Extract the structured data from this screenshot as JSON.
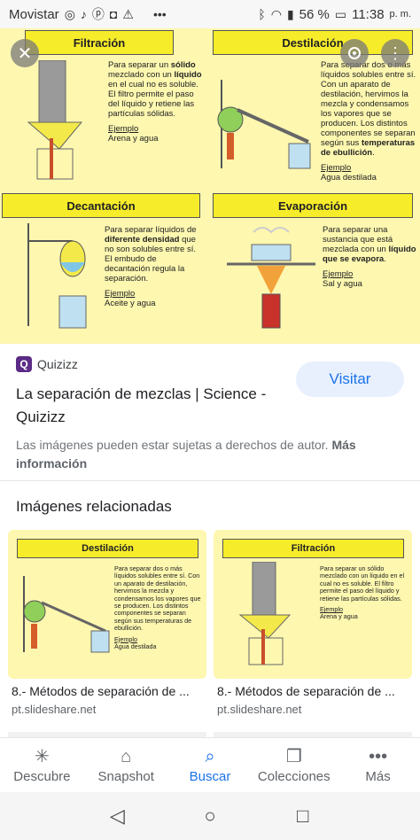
{
  "status_bar": {
    "carrier": "Movistar",
    "battery": "56 %",
    "time": "11:38",
    "ampm": "p. m."
  },
  "image": {
    "panels": [
      {
        "title": "Filtración",
        "text_parts": [
          "Para separar un ",
          "sólido",
          " mezclado con un ",
          "líquido",
          " en el cual no es soluble. El filtro permite el paso del líquido y retiene las partículas sólidas."
        ],
        "ejemplo_label": "Ejemplo",
        "ejemplo_value": "Arena y agua"
      },
      {
        "title": "Destilación",
        "text_parts": [
          "Para separar dos o más líquidos solubles entre sí. Con un aparato de destilación, hervimos la mezcla y condensamos los vapores que se producen. Los distintos componentes se separan según sus ",
          "temperaturas de ebullición",
          "."
        ],
        "ejemplo_label": "Ejemplo",
        "ejemplo_value": "Agua destilada"
      },
      {
        "title": "Decantación",
        "text_parts": [
          "Para separar líquidos de ",
          "diferente densidad",
          " que no son solubles entre sí. El embudo de decantación regula la separación."
        ],
        "ejemplo_label": "Ejemplo",
        "ejemplo_value": "Aceite y agua"
      },
      {
        "title": "Evaporación",
        "text_parts": [
          "Para separar una sustancia que está mezclada con un ",
          "líquido que se evapora",
          "."
        ],
        "ejemplo_label": "Ejemplo",
        "ejemplo_value": "Sal y agua"
      }
    ]
  },
  "source": {
    "name": "Quizizz",
    "favicon_letter": "Q",
    "visit_label": "Visitar",
    "title": "La separación de mezclas | Science - Quizizz",
    "copyright": "Las imágenes pueden estar sujetas a derechos de autor.",
    "more_info": "Más información"
  },
  "related": {
    "heading": "Imágenes relacionadas",
    "items": [
      {
        "thumb_title": "Destilación",
        "thumb_text": "Para separar dos o más líquidos solubles entre sí. Con un aparato de destilación, hervimos la mezcla y condensamos los vapores que se producen. Los distintos componentes se separan según sus temperaturas de ebullición.",
        "thumb_ejemplo": "Ejemplo",
        "thumb_value": "Agua destilada",
        "caption": "8.- Métodos de separación de ...",
        "source": "pt.slideshare.net"
      },
      {
        "thumb_title": "Filtración",
        "thumb_text": "Para separar un sólido mezclado con un líquido en el cual no es soluble. El filtro permite el paso del líquido y retiene las partículas sólidas.",
        "thumb_ejemplo": "Ejemplo",
        "thumb_value": "Arena y agua",
        "caption": "8.- Métodos de separación de ...",
        "source": "pt.slideshare.net"
      }
    ]
  },
  "bottom_nav": [
    {
      "label": "Descubre",
      "icon": "asterisk-icon"
    },
    {
      "label": "Snapshot",
      "icon": "snapshot-icon"
    },
    {
      "label": "Buscar",
      "icon": "search-icon"
    },
    {
      "label": "Colecciones",
      "icon": "bookmark-icon"
    },
    {
      "label": "Más",
      "icon": "more-dots-icon"
    }
  ],
  "colors": {
    "accent": "#1a73e8",
    "panel_bg": "#fdf7b0",
    "title_bg": "#f7ec2a"
  }
}
